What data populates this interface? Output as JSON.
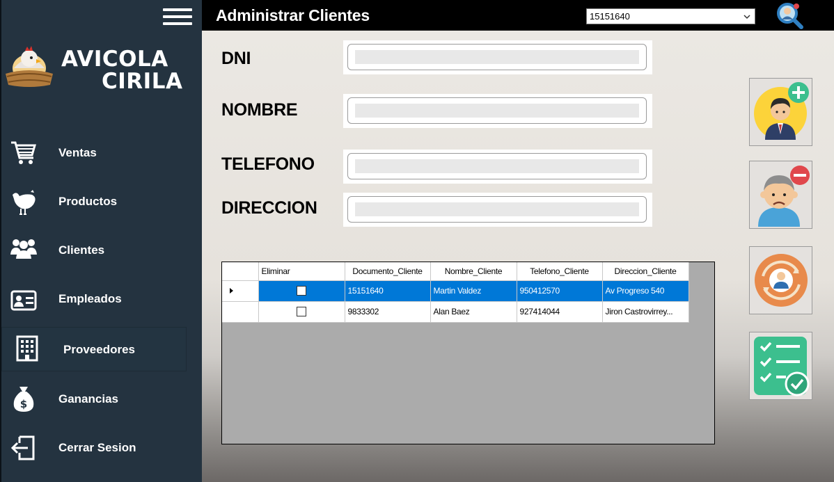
{
  "brand": {
    "line1": "AVICOLA",
    "line2": "CIRILA"
  },
  "sidebar": {
    "items": [
      {
        "label": "Ventas",
        "icon": "cart-icon"
      },
      {
        "label": "Productos",
        "icon": "chicken-icon"
      },
      {
        "label": "Clientes",
        "icon": "group-icon"
      },
      {
        "label": "Empleados",
        "icon": "id-card-icon"
      },
      {
        "label": "Proveedores",
        "icon": "building-icon"
      },
      {
        "label": "Ganancias",
        "icon": "money-bag-icon"
      },
      {
        "label": "Cerrar Sesion",
        "icon": "logout-icon"
      }
    ]
  },
  "header": {
    "title": "Administrar Clientes",
    "combo_value": "15151640"
  },
  "form": {
    "dni_label": "DNI",
    "nombre_label": "NOMBRE",
    "telefono_label": "TELEFONO",
    "direccion_label": "DIRECCION"
  },
  "grid": {
    "columns": [
      "Eliminar",
      "Documento_Cliente",
      "Nombre_Cliente",
      "Telefono_Cliente",
      "Direccion_Cliente"
    ],
    "rows": [
      {
        "documento": "15151640",
        "nombre": "Martin Valdez",
        "telefono": "950412570",
        "direccion": "Av Progreso 540",
        "selected": true,
        "eliminar": false
      },
      {
        "documento": "9833302",
        "nombre": "Alan Baez",
        "telefono": "927414044",
        "direccion": "Jiron Castrovirrey...",
        "selected": false,
        "eliminar": false
      }
    ]
  },
  "actions": {
    "add": "add-client-icon",
    "delete": "delete-client-icon",
    "update": "update-client-icon",
    "list": "checklist-icon"
  },
  "colors": {
    "sidebar": "#243340",
    "topbar": "#000000",
    "selection": "#0078d7",
    "accent_green": "#3cbf8e",
    "accent_red": "#e0474c"
  }
}
